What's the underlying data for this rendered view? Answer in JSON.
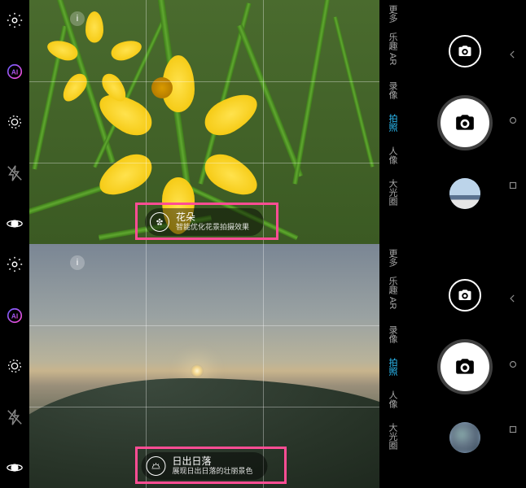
{
  "screens": [
    {
      "scene_badge": {
        "title": "花朵",
        "subtitle": "智能优化花景拍摄效果",
        "icon": "flower"
      },
      "thumbnail_desc": "landscape-photo"
    },
    {
      "scene_badge": {
        "title": "日出日落",
        "subtitle": "展现日出日落的壮丽景色",
        "icon": "sun"
      },
      "thumbnail_desc": "blurred-photo"
    }
  ],
  "modes": [
    {
      "label": "更多",
      "active": false
    },
    {
      "label": "乐趣 AR",
      "active": false
    },
    {
      "label": "录像",
      "active": false
    },
    {
      "label": "拍照",
      "active": true
    },
    {
      "label": "人像",
      "active": false
    },
    {
      "label": "大光圈",
      "active": false
    }
  ],
  "left_icons": [
    "settings",
    "ai",
    "live",
    "flash-off",
    "eye"
  ],
  "info_icon_char": "i",
  "colors": {
    "highlight": "#ff4d94",
    "active_mode": "#2ec4ff"
  }
}
